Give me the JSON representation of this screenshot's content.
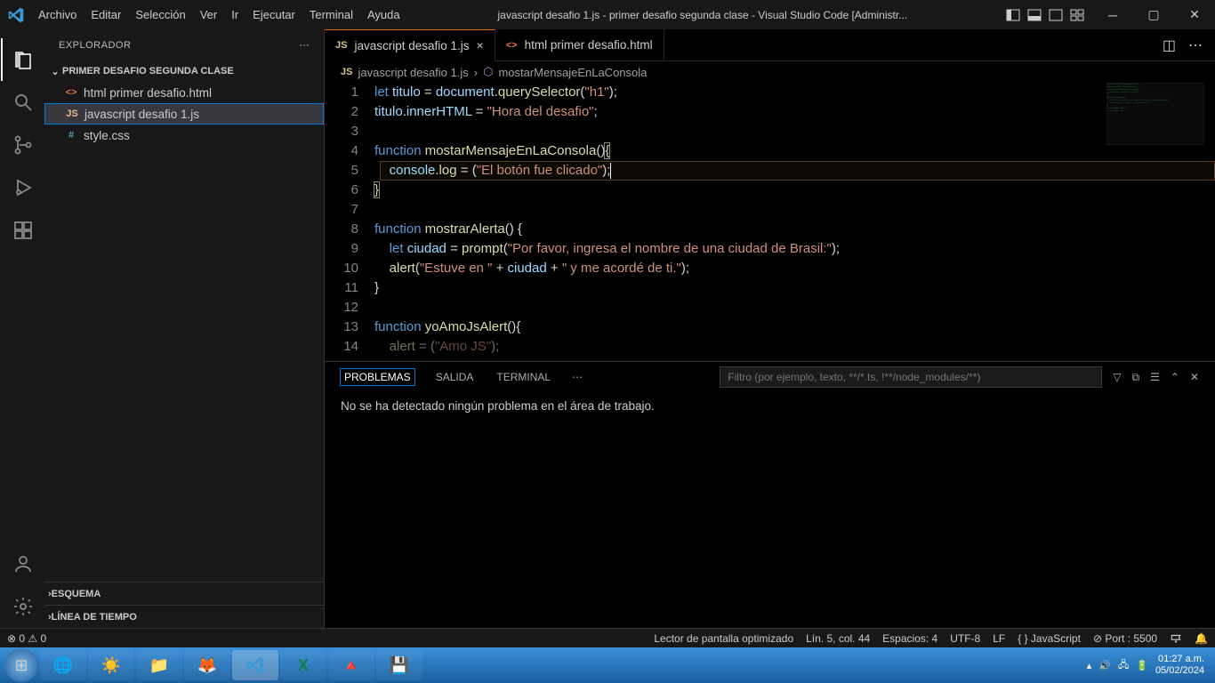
{
  "titlebar": {
    "menu": [
      "Archivo",
      "Editar",
      "Selección",
      "Ver",
      "Ir",
      "Ejecutar",
      "Terminal",
      "Ayuda"
    ],
    "title": "javascript desafio 1.js - primer desafio segunda clase - Visual Studio Code [Administr..."
  },
  "sidebar": {
    "header": "EXPLORADOR",
    "project": "PRIMER DESAFIO SEGUNDA CLASE",
    "files": [
      {
        "icon": "<>",
        "iconColor": "#e37933",
        "name": "html primer desafio.html"
      },
      {
        "icon": "JS",
        "iconColor": "#e2c08d",
        "name": "javascript desafio 1.js",
        "active": true
      },
      {
        "icon": "#",
        "iconColor": "#519aba",
        "name": "style.css"
      }
    ],
    "outline": "ESQUEMA",
    "timeline": "LÍNEA DE TIEMPO"
  },
  "tabs": [
    {
      "icon": "JS",
      "iconColor": "#e2c08d",
      "label": "javascript desafio 1.js",
      "active": true,
      "close": true
    },
    {
      "icon": "<>",
      "iconColor": "#e37933",
      "label": "html primer desafio.html",
      "active": false
    }
  ],
  "breadcrumb": {
    "file": "javascript desafio 1.js",
    "symbol": "mostarMensajeEnLaConsola"
  },
  "code": {
    "lines": [
      {
        "n": 1,
        "html": "<span class='tk-blue'>let</span> <span class='tk-var'>titulo</span> <span class='tk-op'>=</span> <span class='tk-var'>document</span><span class='tk-op'>.</span><span class='tk-fn'>querySelector</span><span class='tk-op'>(</span><span class='tk-str'>\"h1\"</span><span class='tk-op'>);</span>"
      },
      {
        "n": 2,
        "html": "<span class='tk-var'>titulo</span><span class='tk-op'>.</span><span class='tk-var'>innerHTML</span> <span class='tk-op'>=</span> <span class='tk-str'>\"Hora del desafio\"</span><span class='tk-op'>;</span>"
      },
      {
        "n": 3,
        "html": ""
      },
      {
        "n": 4,
        "html": "<span class='tk-blue'>function</span> <span class='tk-fn'>mostarMensajeEnLaConsola</span><span class='tk-op'>()</span><span class='tk-fn bracket-box'>{</span>"
      },
      {
        "n": 5,
        "html": "    <span class='tk-var'>console</span><span class='tk-op'>.</span><span class='tk-fn'>log</span> <span class='tk-op'>=</span> <span class='tk-op'>(</span><span class='tk-str'>\"El botón fue clicado\"</span><span class='tk-op'>);</span><span class='cursor-bar'></span>",
        "hl": true
      },
      {
        "n": 6,
        "html": "<span class='tk-fn bracket-box'>}</span>"
      },
      {
        "n": 7,
        "html": ""
      },
      {
        "n": 8,
        "html": "<span class='tk-blue'>function</span> <span class='tk-fn'>mostrarAlerta</span><span class='tk-op'>() {</span>"
      },
      {
        "n": 9,
        "html": "    <span class='tk-blue'>let</span> <span class='tk-var'>ciudad</span> <span class='tk-op'>=</span> <span class='tk-fn'>prompt</span><span class='tk-op'>(</span><span class='tk-str'>\"Por favor, ingresa el nombre de una ciudad de Brasil:\"</span><span class='tk-op'>);</span>"
      },
      {
        "n": 10,
        "html": "    <span class='tk-fn'>alert</span><span class='tk-op'>(</span><span class='tk-str'>\"Estuve en \"</span> <span class='tk-op'>+</span> <span class='tk-var'>ciudad</span> <span class='tk-op'>+</span> <span class='tk-str'>\" y me acordé de ti.\"</span><span class='tk-op'>);</span>"
      },
      {
        "n": 11,
        "html": "<span class='tk-op'>}</span>"
      },
      {
        "n": 12,
        "html": ""
      },
      {
        "n": 13,
        "html": "<span class='tk-blue'>function</span> <span class='tk-fn'>yoAmoJsAlert</span><span class='tk-op'>(){</span>"
      },
      {
        "n": 14,
        "html": "    <span class='tk-fn'>alert</span> <span class='tk-op'>= (</span><span class='tk-str'>\"Amo JS\"</span><span class='tk-op'>);</span>",
        "cut": true
      }
    ]
  },
  "panel": {
    "tabs": [
      "PROBLEMAS",
      "SALIDA",
      "TERMINAL"
    ],
    "activeTab": 0,
    "filterPlaceholder": "Filtro (por ejemplo, texto, **/*.ts, !**/node_modules/**)",
    "body": "No se ha detectado ningún problema en el área de trabajo."
  },
  "statusbar": {
    "left": [
      "⊗ 0 ⚠ 0"
    ],
    "right": [
      "Lector de pantalla optimizado",
      "Lín. 5, col. 44",
      "Espacios: 4",
      "UTF-8",
      "LF",
      "{ } JavaScript",
      "⊘ Port : 5500"
    ]
  },
  "taskbar": {
    "time": "01:27 a.m.",
    "date": "05/02/2024"
  }
}
